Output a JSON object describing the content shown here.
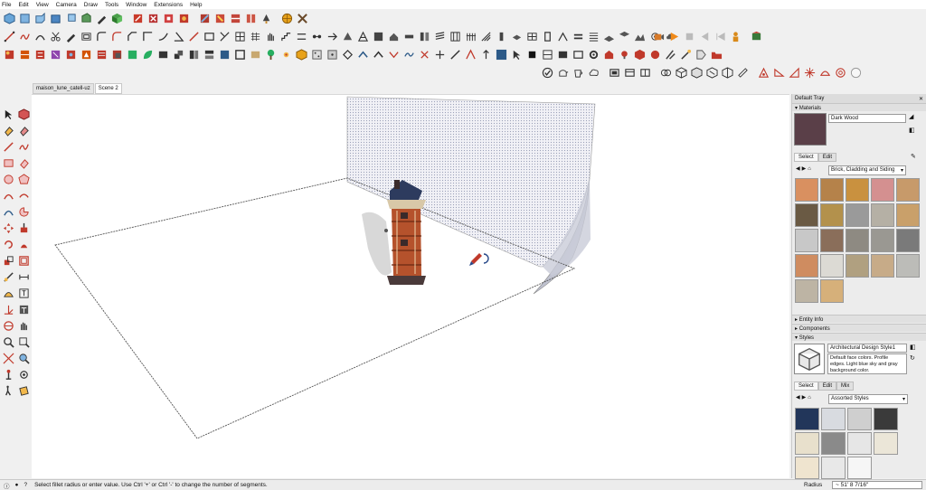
{
  "menu": [
    "File",
    "Edit",
    "View",
    "Camera",
    "Draw",
    "Tools",
    "Window",
    "Extensions",
    "Help"
  ],
  "scene_tabs": [
    "maison_lune_catell-uz",
    "Scene 2"
  ],
  "tray": {
    "title": "Default Tray",
    "materials": {
      "header": "Materials",
      "current_name": "Dark Wood",
      "current_color": "#5a3f48",
      "tab_select": "Select",
      "tab_edit": "Edit",
      "library": "Brick, Cladding and Siding",
      "swatches": [
        "#d99060",
        "#b5824a",
        "#c9913f",
        "#d49090",
        "#c79a6a",
        "#6a5a44",
        "#b3914c",
        "#9a9a9a",
        "#b5b0a5",
        "#c9a06a",
        "#c8c8c8",
        "#8a6e5a",
        "#8e8a82",
        "#9a9892",
        "#7a7a7a",
        "#cf8c60",
        "#dcdad4",
        "#b0a080",
        "#c7ab88",
        "#bcbcb8",
        "#bdb4a4",
        "#d6b07a"
      ]
    },
    "entity_info": "Entity Info",
    "components": "Components",
    "styles": {
      "header": "Styles",
      "style_name": "Architectural Design Style1",
      "description": "Default face colors. Profile edges. Light blue sky and gray background color.",
      "tab_select": "Select",
      "tab_edit": "Edit",
      "tab_mix": "Mix",
      "collection": "Assorted Styles"
    }
  },
  "status": {
    "message": "Select fillet radius or enter value. Use Ctrl '+' or Ctrl '-' to change the number of segments.",
    "measure_label": "Radius",
    "measure_value": "~ 51' 8 7/16\""
  }
}
